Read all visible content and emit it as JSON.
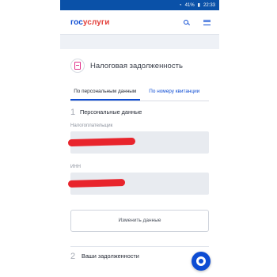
{
  "status_bar": {
    "battery": "41%",
    "time": "22:33"
  },
  "header": {
    "logo_part1": "гос",
    "logo_part2": "услуги",
    "search_icon": "search-icon",
    "menu_icon": "menu-icon"
  },
  "page": {
    "title": "Налоговая задолженность",
    "title_icon": "document-icon"
  },
  "tabs": [
    {
      "label": "По персональным данным",
      "active": true
    },
    {
      "label": "По номеру квитанции",
      "active": false
    }
  ],
  "step1": {
    "number": "1",
    "label": "Персональные данные"
  },
  "fields": {
    "taxpayer_label": "Налогоплательщик",
    "inn_label": "ИНН"
  },
  "change_button": "Изменить данные",
  "step2": {
    "number": "2",
    "label": "Ваши задолженности"
  },
  "colors": {
    "brand_blue": "#0d4cd3",
    "brand_red": "#e3403b",
    "status_bar": "#0a51a8"
  }
}
